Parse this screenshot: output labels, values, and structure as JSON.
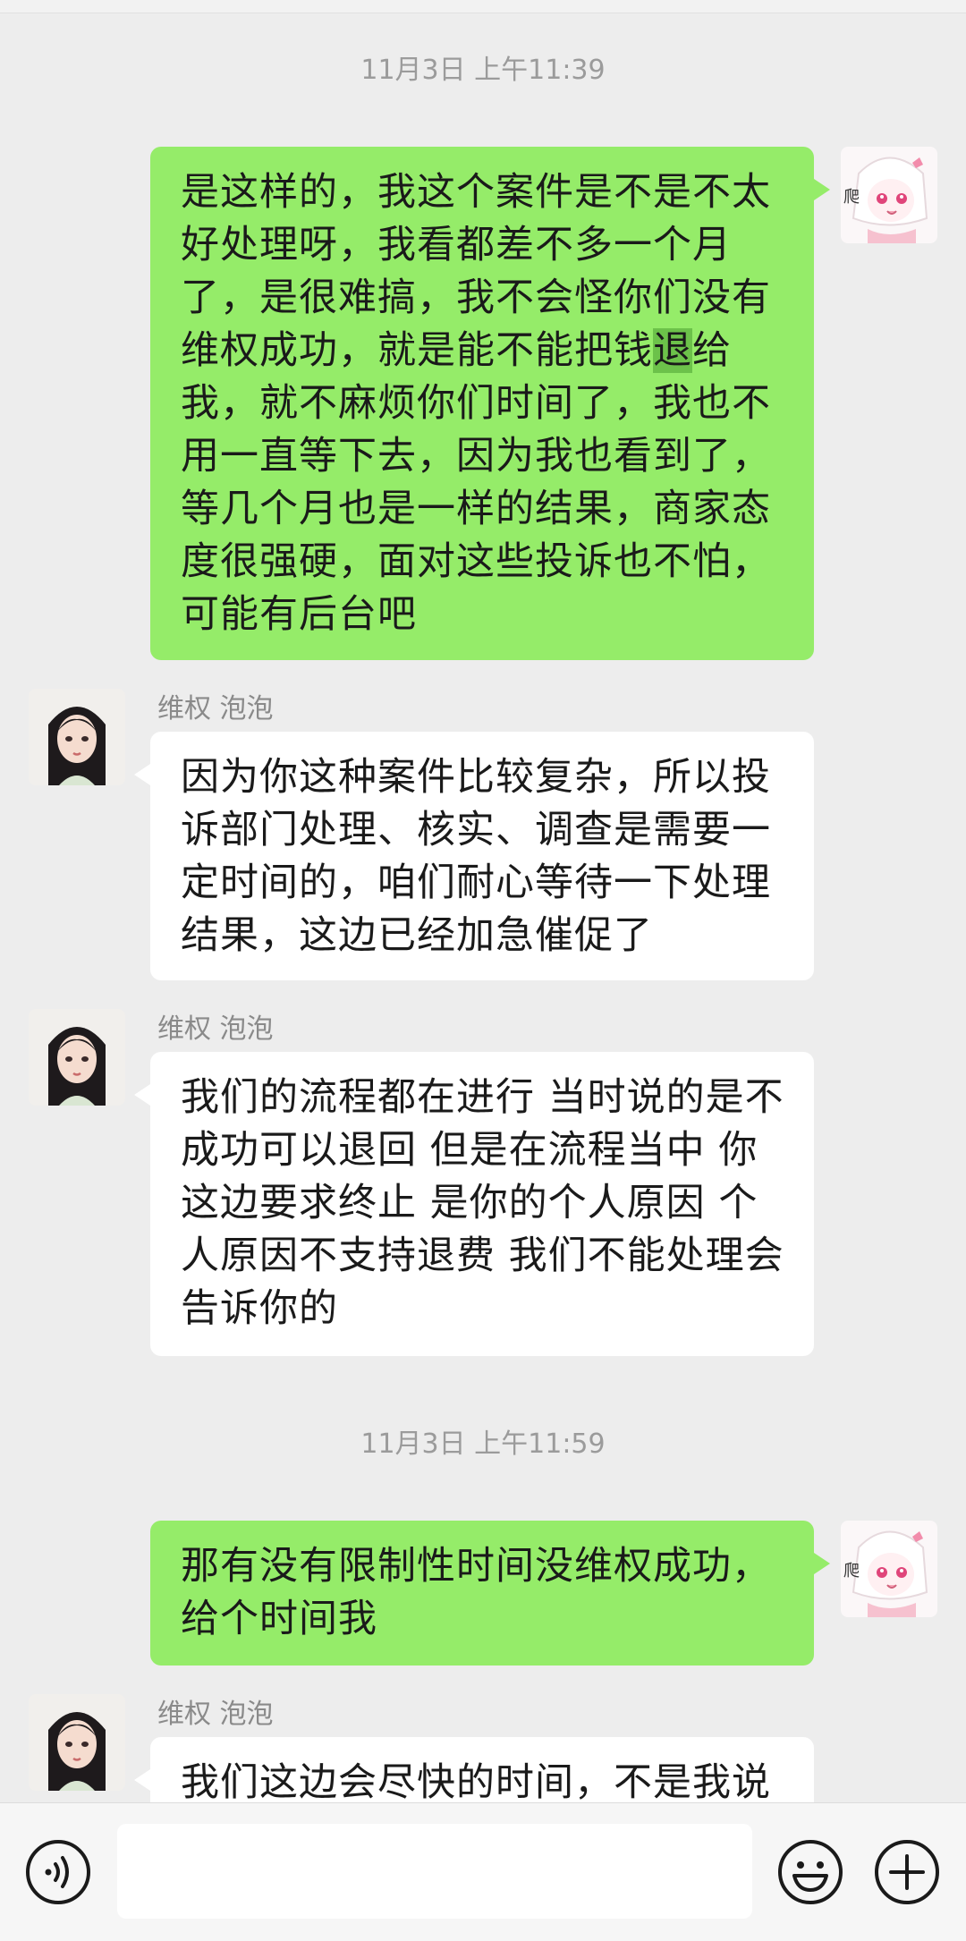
{
  "conversation": {
    "timestamp_1": "11月3日 上午11:39",
    "timestamp_2": "11月3日 上午11:59",
    "messages": [
      {
        "side": "right",
        "text_before_highlight": "是这样的，我这个案件是不是不太好处理呀，我看都差不多一个月了，是很难搞，我不会怪你们没有维权成功，就是能不能把钱",
        "highlight": "退",
        "text_after_highlight": "给我，就不麻烦你们时间了，我也不用一直等下去，因为我也看到了，等几个月也是一样的结果，商家态度很强硬，面对这些投诉也不怕，可能有后台吧"
      },
      {
        "side": "left",
        "sender": "维权 泡泡",
        "text": "因为你这种案件比较复杂，所以投诉部门处理、核实、调查是需要一定时间的，咱们耐心等待一下处理结果，这边已经加急催促了"
      },
      {
        "side": "left",
        "sender": "维权 泡泡",
        "text": "我们的流程都在进行 当时说的是不成功可以退回 但是在流程当中 你这边要求终止 是你的个人原因 个人原因不支持退费 我们不能处理会告诉你的"
      },
      {
        "side": "right",
        "text": "那有没有限制性时间没维权成功，给个时间我"
      },
      {
        "side": "left",
        "sender": "维权 泡泡",
        "text": "我们这边会尽快的时间，不是我说"
      }
    ],
    "avatar_badge_char": "爬"
  },
  "input_bar": {
    "voice_icon": "voice-icon",
    "emoji_icon": "emoji-icon",
    "plus_icon": "plus-icon",
    "input_value": ""
  },
  "colors": {
    "background": "#ededed",
    "bubble_self": "#95ec69",
    "bubble_other": "#ffffff",
    "highlight": "#6cc24a"
  }
}
